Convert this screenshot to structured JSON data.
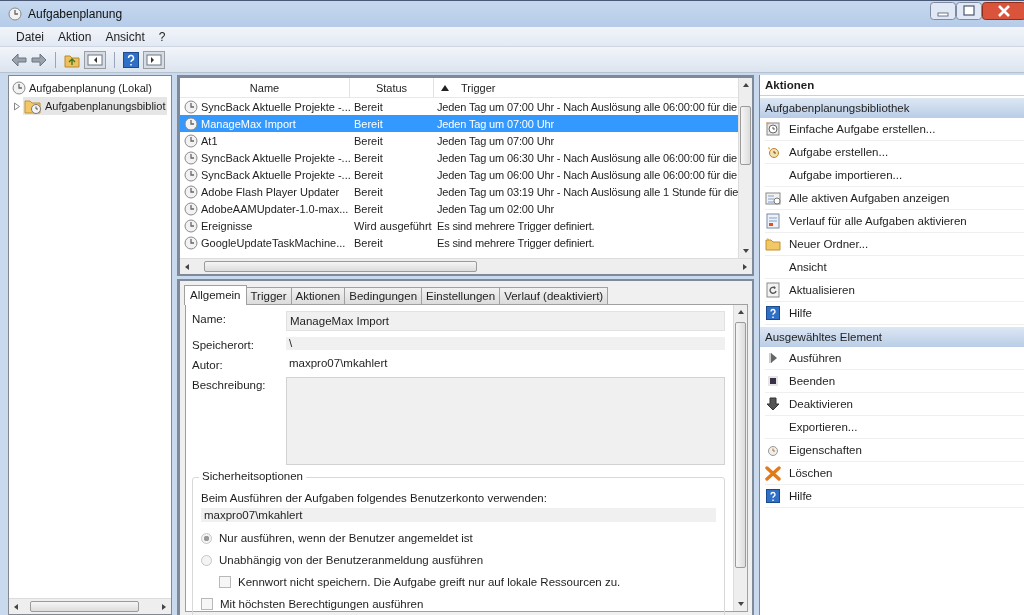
{
  "window": {
    "title": "Aufgabenplanung"
  },
  "menu": [
    {
      "label": "Datei"
    },
    {
      "label": "Aktion"
    },
    {
      "label": "Ansicht"
    },
    {
      "label": "?"
    }
  ],
  "tree": [
    {
      "label": "Aufgabenplanung (Lokal)",
      "children": [
        {
          "label": "Aufgabenplanungsbibliot",
          "expanded": false,
          "selected": true
        }
      ]
    }
  ],
  "table": {
    "columns": [
      {
        "label": "Name",
        "sorted": false
      },
      {
        "label": "Status",
        "sorted": false
      },
      {
        "label": "Trigger",
        "sorted": true
      }
    ],
    "rows": [
      {
        "name": "SyncBack Aktuelle Projekte -...",
        "status": "Bereit",
        "trigger": "Jeden Tag um 07:00 Uhr - Nach Auslösung alle 06:00:00 für die",
        "selected": false
      },
      {
        "name": "ManageMax Import",
        "status": "Bereit",
        "trigger": "Jeden Tag um 07:00 Uhr",
        "selected": true
      },
      {
        "name": "At1",
        "status": "Bereit",
        "trigger": "Jeden Tag um 07:00 Uhr",
        "selected": false
      },
      {
        "name": "SyncBack Aktuelle Projekte -...",
        "status": "Bereit",
        "trigger": "Jeden Tag um 06:30 Uhr - Nach Auslösung alle 06:00:00 für die",
        "selected": false
      },
      {
        "name": "SyncBack Aktuelle Projekte -...",
        "status": "Bereit",
        "trigger": "Jeden Tag um 06:00 Uhr - Nach Auslösung alle 06:00:00 für die",
        "selected": false
      },
      {
        "name": "Adobe Flash Player Updater",
        "status": "Bereit",
        "trigger": "Jeden Tag um 03:19 Uhr - Nach Auslösung alle 1 Stunde für die",
        "selected": false
      },
      {
        "name": "AdobeAAMUpdater-1.0-max...",
        "status": "Bereit",
        "trigger": "Jeden Tag um 02:00 Uhr",
        "selected": false
      },
      {
        "name": "Ereignisse",
        "status": "Wird ausgeführt",
        "trigger": "Es sind mehrere Trigger definiert.",
        "selected": false
      },
      {
        "name": "GoogleUpdateTaskMachine...",
        "status": "Bereit",
        "trigger": "Es sind mehrere Trigger definiert.",
        "selected": false
      }
    ]
  },
  "tabs": [
    {
      "label": "Allgemein",
      "selected": true
    },
    {
      "label": "Trigger",
      "selected": false
    },
    {
      "label": "Aktionen",
      "selected": false
    },
    {
      "label": "Bedingungen",
      "selected": false
    },
    {
      "label": "Einstellungen",
      "selected": false
    },
    {
      "label": "Verlauf (deaktiviert)",
      "selected": false
    }
  ],
  "general": {
    "fields": [
      {
        "kind": "field",
        "label": "Name:",
        "value": "ManageMax Import"
      },
      {
        "kind": "line",
        "label": "Speicherort:",
        "value": "\\"
      },
      {
        "kind": "text",
        "label": "Autor:",
        "value": "maxpro07\\mkahlert"
      },
      {
        "kind": "area",
        "label": "Beschreibung:"
      }
    ],
    "security": {
      "title": "Sicherheitsoptionen",
      "account_label": "Beim Ausführen der Aufgaben folgendes Benutzerkonto verwenden:",
      "account": "maxpro07\\mkahlert",
      "options": [
        {
          "kind": "radio",
          "label": "Nur ausführen, wenn der Benutzer angemeldet ist",
          "selected": true
        },
        {
          "kind": "radio",
          "label": "Unabhängig von der Benutzeranmeldung ausführen",
          "selected": false,
          "children": [
            {
              "kind": "checkbox",
              "label": "Kennwort nicht speichern. Die Aufgabe greift nur auf lokale Ressourcen zu.",
              "checked": false
            }
          ]
        },
        {
          "kind": "checkbox",
          "label": "Mit höchsten Berechtigungen ausführen",
          "checked": false
        }
      ]
    }
  },
  "actions": {
    "title": "Aktionen",
    "sections": [
      {
        "title": "Aufgabenplanungsbibliothek",
        "items": [
          {
            "label": "Einfache Aufgabe erstellen...",
            "kind": "wizard"
          },
          {
            "label": "Aufgabe erstellen...",
            "kind": "task"
          },
          {
            "label": "Aufgabe importieren...",
            "kind": "plain"
          },
          {
            "label": "Alle aktiven Aufgaben anzeigen",
            "kind": "list"
          },
          {
            "label": "Verlauf für alle Aufgaben aktivieren",
            "kind": "history"
          },
          {
            "label": "Neuer Ordner...",
            "kind": "folder"
          },
          {
            "label": "Ansicht",
            "kind": "plain"
          },
          {
            "label": "Aktualisieren",
            "kind": "refresh"
          },
          {
            "label": "Hilfe",
            "kind": "help"
          }
        ]
      },
      {
        "title": "Ausgewähltes Element",
        "items": [
          {
            "label": "Ausführen",
            "kind": "run"
          },
          {
            "label": "Beenden",
            "kind": "stop"
          },
          {
            "label": "Deaktivieren",
            "kind": "disable"
          },
          {
            "label": "Exportieren...",
            "kind": "plain"
          },
          {
            "label": "Eigenschaften",
            "kind": "properties"
          },
          {
            "label": "Löschen",
            "kind": "delete"
          },
          {
            "label": "Hilfe",
            "kind": "help"
          }
        ]
      }
    ]
  }
}
